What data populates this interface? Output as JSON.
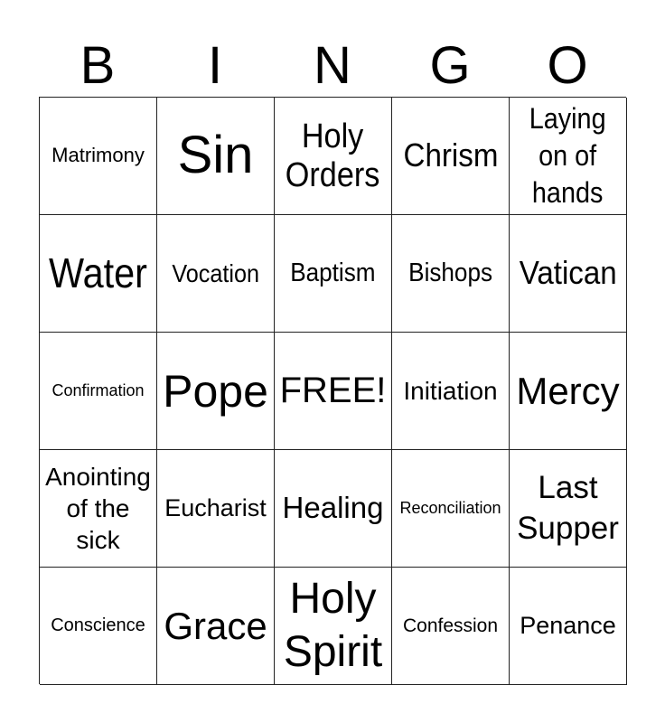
{
  "header": {
    "letters": [
      "B",
      "I",
      "N",
      "G",
      "O"
    ]
  },
  "grid": {
    "rows": [
      [
        "Matrimony",
        "Sin",
        "Holy\nOrders",
        "Chrism",
        "Laying\non of\nhands"
      ],
      [
        "Water",
        "Vocation",
        "Baptism",
        "Bishops",
        "Vatican"
      ],
      [
        "Confirmation",
        "Pope",
        "FREE!",
        "Initiation",
        "Mercy"
      ],
      [
        "Anointing\nof the\nsick",
        "Eucharist",
        "Healing",
        "Reconciliation",
        "Last\nSupper"
      ],
      [
        "Conscience",
        "Grace",
        "Holy\nSpirit",
        "Confession",
        "Penance"
      ]
    ]
  },
  "colors": {
    "line": "#222222",
    "text": "#000000",
    "background": "#ffffff"
  }
}
